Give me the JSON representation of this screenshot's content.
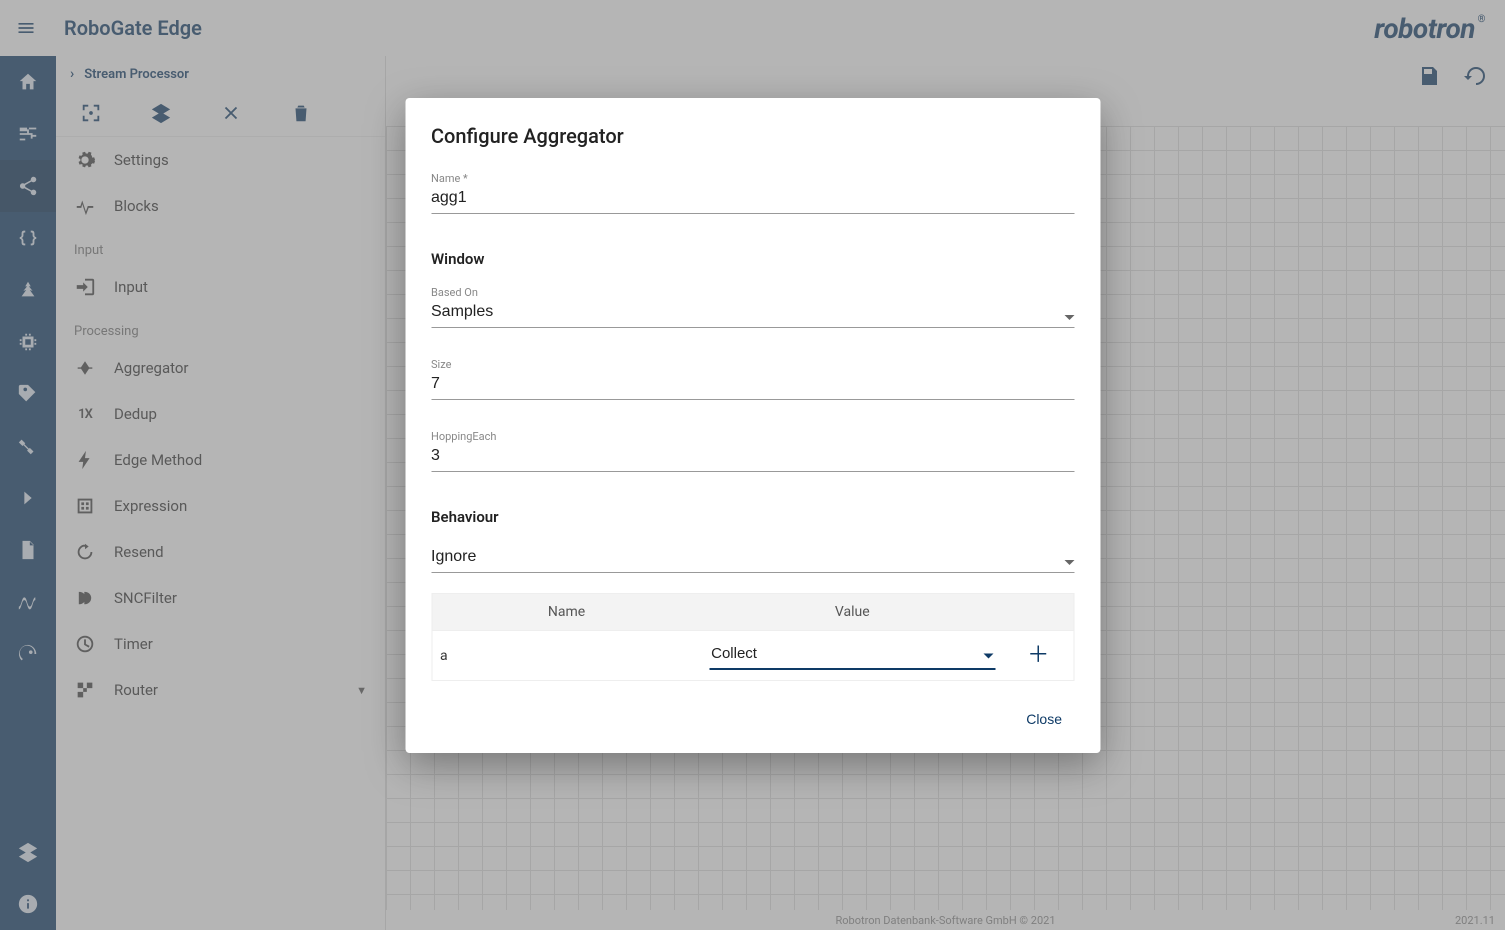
{
  "app": {
    "title": "RoboGate Edge",
    "brand": "robotron"
  },
  "rail": [
    {
      "name": "home-icon"
    },
    {
      "name": "tune-icon"
    },
    {
      "name": "share-icon",
      "active": true
    },
    {
      "name": "braces-icon"
    },
    {
      "name": "graph-icon"
    },
    {
      "name": "chip-icon"
    },
    {
      "name": "tag-icon"
    },
    {
      "name": "stream-icon"
    },
    {
      "name": "chevron-right-icon"
    },
    {
      "name": "document-icon"
    },
    {
      "name": "wave-icon"
    },
    {
      "name": "orbit-icon"
    }
  ],
  "rail_bottom": [
    {
      "name": "layers-icon"
    },
    {
      "name": "info-icon"
    }
  ],
  "breadcrumb": {
    "label": "Stream Processor"
  },
  "panel": {
    "settings": "Settings",
    "blocks": "Blocks",
    "headers": {
      "input": "Input",
      "processing": "Processing"
    },
    "items": {
      "input": "Input",
      "aggregator": "Aggregator",
      "dedup": "Dedup",
      "edge_method": "Edge Method",
      "expression": "Expression",
      "resend": "Resend",
      "sncfilter": "SNCFilter",
      "timer": "Timer",
      "router": "Router"
    }
  },
  "dialog": {
    "title": "Configure Aggregator",
    "name_label": "Name *",
    "name_value": "agg1",
    "section_window": "Window",
    "based_on_label": "Based On",
    "based_on_value": "Samples",
    "size_label": "Size",
    "size_value": "7",
    "hopping_label": "HoppingEach",
    "hopping_value": "3",
    "section_behaviour": "Behaviour",
    "behaviour_value": "Ignore",
    "table": {
      "col_name": "Name",
      "col_value": "Value",
      "row_name": "a",
      "row_value": "Collect"
    },
    "close": "Close"
  },
  "footer": {
    "copyright": "Robotron Datenbank-Software GmbH © 2021",
    "version": "2021.11"
  }
}
